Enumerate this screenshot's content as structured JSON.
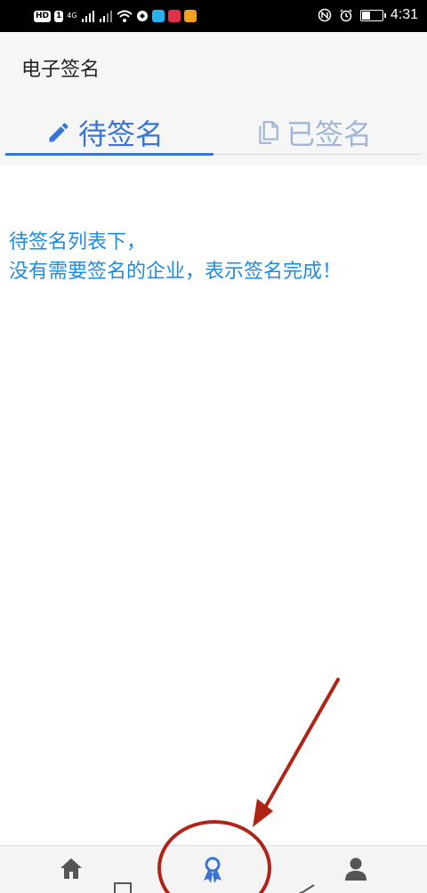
{
  "status_bar": {
    "hd_badge": "HD",
    "sim_badge": "1",
    "network_label": "4G",
    "time": "4:31",
    "battery_level": 0.45
  },
  "header": {
    "title": "电子签名"
  },
  "tabs": [
    {
      "label": "待签名",
      "icon": "pencil-icon",
      "active": true
    },
    {
      "label": "已签名",
      "icon": "copy-document-icon",
      "active": false
    }
  ],
  "content": {
    "info_line_1": "待签名列表下，",
    "info_line_2": "没有需要签名的企业，表示签名完成！"
  },
  "bottom_nav": {
    "items": [
      {
        "label": "",
        "icon": "home-icon"
      },
      {
        "label": "",
        "icon": "square-icon"
      },
      {
        "label": "",
        "icon": "ribbon-award-icon",
        "active": true
      },
      {
        "label": "",
        "icon": "send-icon"
      },
      {
        "label": "",
        "icon": "person-icon"
      }
    ]
  },
  "colors": {
    "accent": "#3a76d1",
    "inactive_tab": "#9fb6d9",
    "info_text": "#1f8be0",
    "annotation": "#b02418"
  }
}
